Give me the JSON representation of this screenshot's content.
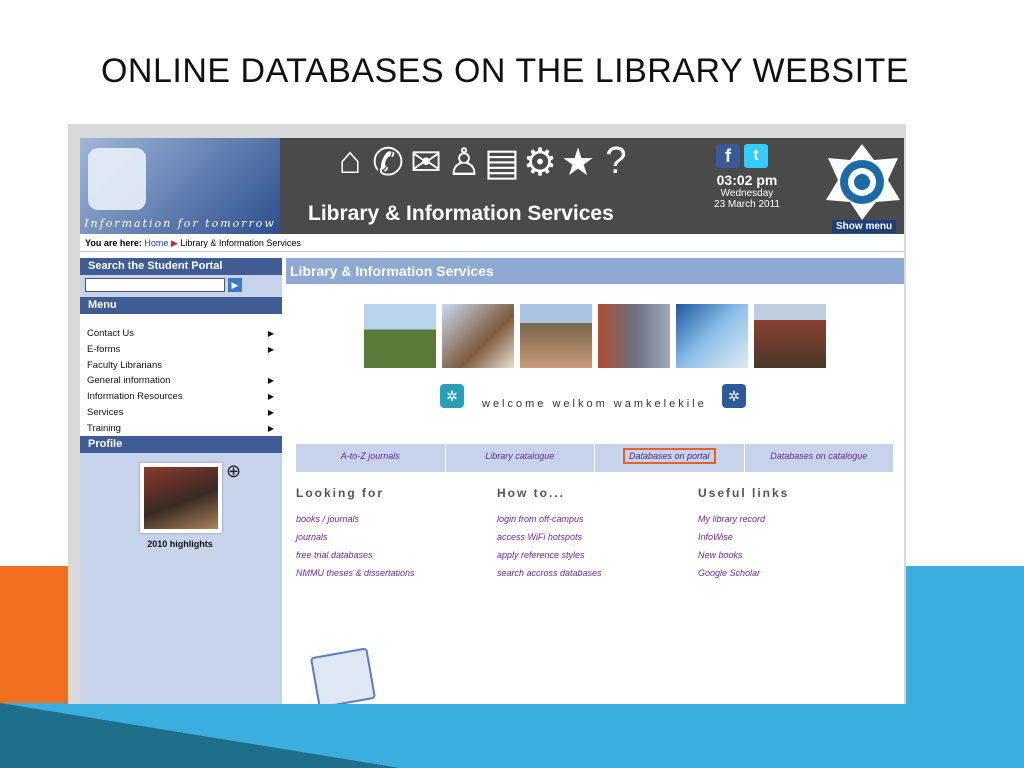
{
  "slide": {
    "title": "ONLINE DATABASES ON THE LIBRARY WEBSITE"
  },
  "banner": {
    "tagline": "Information for tomorrow",
    "title": "Library & Information Services",
    "icons": [
      "home-icon",
      "phone-icon",
      "mail-icon",
      "person-icon",
      "printer-icon",
      "settings-icon",
      "star-icon",
      "help-icon"
    ],
    "social": {
      "facebook": "f",
      "twitter": "t"
    },
    "clock": {
      "time": "03:02 pm",
      "day": "Wednesday",
      "date": "23 March 2011"
    },
    "show_menu": "Show menu"
  },
  "breadcrumb": {
    "prefix": "You are here:",
    "home": "Home",
    "current": "Library & Information Services"
  },
  "sidebar": {
    "search_title": "Search the Student Portal",
    "search_value": "",
    "menu_title": "Menu",
    "menu": [
      {
        "label": "Contact Us",
        "arrow": true
      },
      {
        "label": "E-forms",
        "arrow": true
      },
      {
        "label": "Faculty Librarians",
        "arrow": false
      },
      {
        "label": "General information",
        "arrow": true
      },
      {
        "label": "Information Resources",
        "arrow": true
      },
      {
        "label": "Services",
        "arrow": true
      },
      {
        "label": "Training",
        "arrow": true
      }
    ],
    "profile_title": "Profile",
    "profile_caption": "2010 highlights"
  },
  "main": {
    "title": "Library & Information Services",
    "welcome": "welcome   welkom   wamkelekile",
    "tabs": [
      "A-to-Z journals",
      "Library catalogue",
      "Databases on portal",
      "Databases on catalogue"
    ],
    "selected_tab": 2,
    "columns": [
      {
        "heading": "Looking for",
        "links": [
          "books / journals",
          "journals",
          "free trial databases",
          "NMMU theses & dissertations"
        ]
      },
      {
        "heading": "How to...",
        "links": [
          "login from off-campus",
          "access WiFi hotspots",
          "apply reference styles",
          "search accross databases"
        ]
      },
      {
        "heading": "Useful links",
        "links": [
          "My library record",
          "InfoWise",
          "New books",
          "Google Scholar"
        ]
      }
    ]
  },
  "colors": {
    "accent_orange": "#f07020",
    "accent_blue": "#3aaede",
    "sidebar_blue": "#3f5d94",
    "highlight": "#e8602a"
  }
}
